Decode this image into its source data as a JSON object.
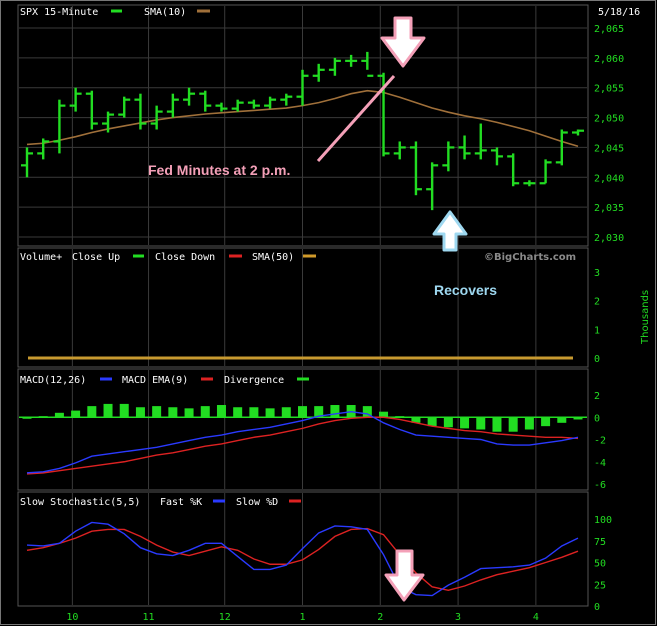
{
  "chart_data": [
    {
      "type": "line",
      "title": "SPX 15-Minute",
      "legend": [
        {
          "name": "SPX 15-Minute",
          "color": "#22dd22"
        },
        {
          "name": "SMA(10)",
          "color": "#a0703a"
        }
      ],
      "date": "5/18/16",
      "y_ticks": [
        "2,065",
        "2,060",
        "2,055",
        "2,050",
        "2,045",
        "2,040",
        "2,035",
        "2,030"
      ],
      "ylim": [
        2029,
        2066
      ],
      "bars": [
        {
          "o": 2042,
          "h": 2045,
          "l": 2040,
          "c": 2044
        },
        {
          "o": 2044,
          "h": 2046.5,
          "l": 2043,
          "c": 2046
        },
        {
          "o": 2046,
          "h": 2053,
          "l": 2044,
          "c": 2052
        },
        {
          "o": 2052,
          "h": 2055,
          "l": 2051,
          "c": 2054
        },
        {
          "o": 2054,
          "h": 2054.5,
          "l": 2048,
          "c": 2049
        },
        {
          "o": 2049,
          "h": 2051,
          "l": 2047.5,
          "c": 2050.5
        },
        {
          "o": 2050.5,
          "h": 2053.5,
          "l": 2050,
          "c": 2053
        },
        {
          "o": 2053,
          "h": 2054,
          "l": 2048,
          "c": 2049
        },
        {
          "o": 2049,
          "h": 2052,
          "l": 2048,
          "c": 2051
        },
        {
          "o": 2051,
          "h": 2054,
          "l": 2050,
          "c": 2053
        },
        {
          "o": 2053,
          "h": 2055,
          "l": 2052,
          "c": 2054
        },
        {
          "o": 2054,
          "h": 2054.5,
          "l": 2051,
          "c": 2052
        },
        {
          "o": 2052,
          "h": 2052.5,
          "l": 2051,
          "c": 2051.5
        },
        {
          "o": 2051.5,
          "h": 2053,
          "l": 2051,
          "c": 2052.5
        },
        {
          "o": 2052.5,
          "h": 2053,
          "l": 2051.5,
          "c": 2052
        },
        {
          "o": 2052,
          "h": 2053.5,
          "l": 2051.5,
          "c": 2053
        },
        {
          "o": 2053,
          "h": 2054,
          "l": 2052,
          "c": 2053.5
        },
        {
          "o": 2053.5,
          "h": 2058,
          "l": 2052,
          "c": 2057
        },
        {
          "o": 2057,
          "h": 2059,
          "l": 2056,
          "c": 2058
        },
        {
          "o": 2058,
          "h": 2060,
          "l": 2057,
          "c": 2059.5
        },
        {
          "o": 2059.5,
          "h": 2060.5,
          "l": 2058.5,
          "c": 2059.5
        },
        {
          "o": 2059.5,
          "h": 2061,
          "l": 2058,
          "c": 2057
        },
        {
          "o": 2057,
          "h": 2057.5,
          "l": 2043.5,
          "c": 2044
        },
        {
          "o": 2044,
          "h": 2046,
          "l": 2043,
          "c": 2045
        },
        {
          "o": 2045,
          "h": 2046,
          "l": 2037,
          "c": 2038
        },
        {
          "o": 2038,
          "h": 2042.5,
          "l": 2034.5,
          "c": 2042
        },
        {
          "o": 2042,
          "h": 2046,
          "l": 2041,
          "c": 2045
        },
        {
          "o": 2045,
          "h": 2047,
          "l": 2043,
          "c": 2044
        },
        {
          "o": 2044,
          "h": 2049,
          "l": 2043,
          "c": 2044.5
        },
        {
          "o": 2044.5,
          "h": 2045,
          "l": 2042,
          "c": 2043.5
        },
        {
          "o": 2043.5,
          "h": 2044,
          "l": 2038.5,
          "c": 2039
        },
        {
          "o": 2039,
          "h": 2039.5,
          "l": 2038.5,
          "c": 2039
        },
        {
          "o": 2039,
          "h": 2043,
          "l": 2039,
          "c": 2042.5
        },
        {
          "o": 2042.5,
          "h": 2048,
          "l": 2042,
          "c": 2047.5
        },
        {
          "o": 2047.5,
          "h": 2048,
          "l": 2047,
          "c": 2047.8
        }
      ],
      "sma10": [
        2045.5,
        2045.7,
        2046.2,
        2046.8,
        2047.5,
        2048.1,
        2048.6,
        2049.1,
        2049.6,
        2050,
        2050.3,
        2050.6,
        2050.8,
        2051,
        2051.2,
        2051.4,
        2051.6,
        2052,
        2052.5,
        2053.2,
        2054,
        2054.5,
        2054.2,
        2053.4,
        2052.5,
        2051.6,
        2050.9,
        2050.3,
        2049.8,
        2049.2,
        2048.5,
        2047.8,
        2046.9,
        2046,
        2045.2
      ]
    },
    {
      "type": "bar",
      "title": "Volume+",
      "legend": [
        {
          "name": "Close Up",
          "color": "#22dd22"
        },
        {
          "name": "Close Down",
          "color": "#dd2222"
        },
        {
          "name": "SMA(50)",
          "color": "#d09a2a"
        }
      ],
      "watermark": "©BigCharts.com",
      "y_ticks": [
        "3",
        "2",
        "1",
        "0"
      ],
      "ylabel": "Thousands",
      "ylim": [
        0,
        3
      ],
      "sma50": 0
    },
    {
      "type": "bar",
      "title": "MACD(12,26)",
      "legend": [
        {
          "name": "MACD",
          "color": "#2a3aff"
        },
        {
          "name": "EMA(9)",
          "color": "#dd2222"
        },
        {
          "name": "Divergence",
          "color": "#22dd22"
        }
      ],
      "y_ticks": [
        "2",
        "0",
        "-2",
        "-4",
        "-6"
      ],
      "ylim": [
        -6.5,
        2.5
      ],
      "divergence": [
        0,
        0.1,
        0.4,
        0.6,
        1.0,
        1.2,
        1.2,
        0.9,
        1.0,
        0.9,
        0.8,
        1.0,
        1.1,
        0.9,
        0.9,
        0.8,
        0.9,
        1.0,
        1.0,
        1.1,
        1.1,
        1.0,
        0.5,
        0.1,
        -0.5,
        -0.8,
        -0.9,
        -1.0,
        -1.1,
        -1.3,
        -1.3,
        -1.1,
        -0.8,
        -0.5,
        -0.2
      ],
      "macd": [
        -5,
        -4.9,
        -4.6,
        -4.1,
        -3.5,
        -3.3,
        -3.1,
        -2.9,
        -2.7,
        -2.4,
        -2.1,
        -1.8,
        -1.6,
        -1.3,
        -1.1,
        -0.9,
        -0.6,
        -0.3,
        0.1,
        0.3,
        0.5,
        0.3,
        -0.5,
        -1.1,
        -1.6,
        -1.7,
        -1.8,
        -1.9,
        -2.0,
        -2.4,
        -2.5,
        -2.5,
        -2.3,
        -2.1,
        -1.8
      ],
      "ema9": [
        -5.1,
        -5.0,
        -4.8,
        -4.6,
        -4.4,
        -4.2,
        -4.0,
        -3.7,
        -3.4,
        -3.2,
        -2.9,
        -2.6,
        -2.4,
        -2.1,
        -1.8,
        -1.6,
        -1.3,
        -1.0,
        -0.6,
        -0.3,
        -0.1,
        0.0,
        0.0,
        -0.2,
        -0.5,
        -0.8,
        -1.0,
        -1.2,
        -1.3,
        -1.5,
        -1.6,
        -1.7,
        -1.8,
        -1.8,
        -1.9
      ]
    },
    {
      "type": "line",
      "title": "Slow Stochastic(5,5)",
      "legend": [
        {
          "name": "Fast %K",
          "color": "#2a3aff"
        },
        {
          "name": "Slow %D",
          "color": "#dd2222"
        }
      ],
      "y_ticks": [
        "100",
        "75",
        "50",
        "25",
        "0"
      ],
      "ylim": [
        0,
        100
      ],
      "x_ticks": [
        {
          "label": "10",
          "i": 2.8
        },
        {
          "label": "11",
          "i": 7.5
        },
        {
          "label": "12",
          "i": 12.2
        },
        {
          "label": "1",
          "i": 17.0
        },
        {
          "label": "2",
          "i": 21.8
        },
        {
          "label": "3",
          "i": 26.6
        },
        {
          "label": "4",
          "i": 31.4
        }
      ],
      "fast_k": [
        70,
        69,
        72,
        86,
        96,
        94,
        83,
        67,
        60,
        58,
        64,
        72,
        72,
        57,
        42,
        42,
        47,
        66,
        84,
        92,
        91,
        88,
        59,
        22,
        13,
        12,
        24,
        33,
        43,
        44,
        45,
        47,
        55,
        69,
        78
      ],
      "slow_d": [
        64,
        67,
        72,
        78,
        86,
        88,
        88,
        80,
        70,
        62,
        58,
        63,
        68,
        64,
        54,
        48,
        48,
        53,
        65,
        80,
        88,
        89,
        82,
        59,
        38,
        22,
        18,
        23,
        30,
        36,
        40,
        44,
        50,
        56,
        63
      ]
    }
  ],
  "annotations": {
    "fed_label": "Fed Minutes at 2 p.m.",
    "recovers_label": "Recovers"
  },
  "colors": {
    "up": "#22dd22",
    "down": "#dd2222",
    "sma10": "#a0703a",
    "sma50": "#c89a30",
    "macd": "#2a3aff",
    "grid": "#3a3a3a",
    "pink_arrow": "#f4a0b8",
    "blue_arrow": "#9ed8f0",
    "fed_text": "#f4a0b8",
    "recovers_text": "#9ed8f0"
  }
}
